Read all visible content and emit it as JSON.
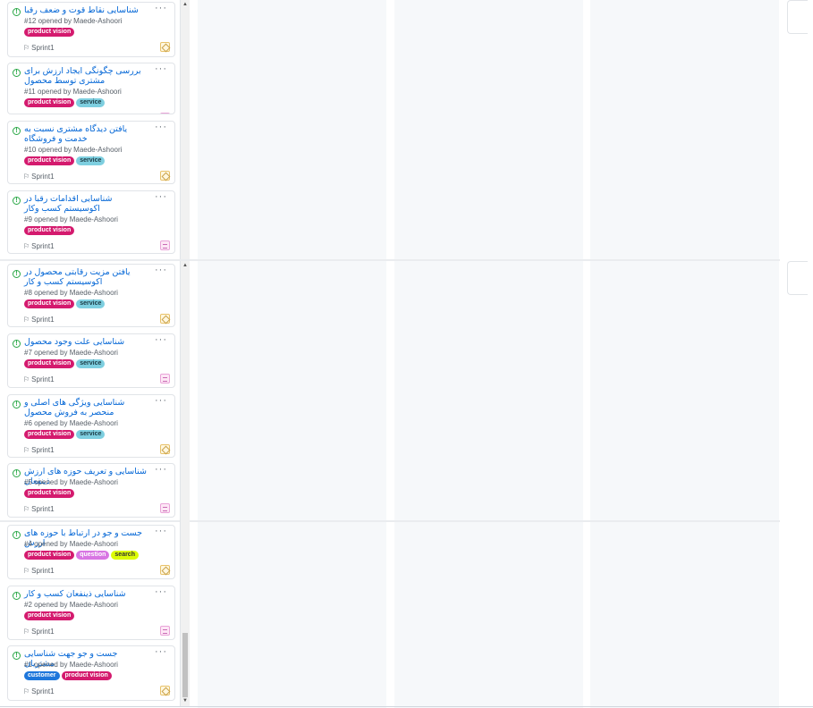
{
  "cards": [
    {
      "title": "شناسایی نقاط قوت و ضعف رقبا",
      "meta": "#12 opened by Maede-Ashoori",
      "labels": [
        "product vision"
      ],
      "milestone": "Sprint1",
      "avatar": "avatar-gold"
    },
    {
      "title": "بررسی چگونگی ایجاد ارزش برای مشتری توسط محصول",
      "meta": "#11 opened by Maede-Ashoori",
      "labels": [
        "product vision",
        "service"
      ],
      "milestone": "Sprint1",
      "avatar": "avatar-pink"
    },
    {
      "title": "یافتن دیدگاه مشتری نسبت به خدمت و فروشگاه",
      "meta": "#10 opened by Maede-Ashoori",
      "labels": [
        "product vision",
        "service"
      ],
      "milestone": "Sprint1",
      "avatar": "avatar-gold"
    },
    {
      "title": "شناسایی اقدامات رقبا در اکوسیستم کسب وکار",
      "meta": "#9 opened by Maede-Ashoori",
      "labels": [
        "product vision"
      ],
      "milestone": "Sprint1",
      "avatar": "avatar-pink"
    },
    {
      "title": "یافتن مزیت رقابتی محصول در اکوسیستم کسب و کار",
      "meta": "#8 opened by Maede-Ashoori",
      "labels": [
        "product vision",
        "service"
      ],
      "milestone": "Sprint1",
      "avatar": "avatar-gold"
    },
    {
      "title": "شناسایی علت وجود محصول",
      "meta": "#7 opened by Maede-Ashoori",
      "labels": [
        "product vision",
        "service"
      ],
      "milestone": "Sprint1",
      "avatar": "avatar-pink"
    },
    {
      "title": "شناسایی ویژگی های اصلی و منحصر به فروش محصول",
      "meta": "#6 opened by Maede-Ashoori",
      "labels": [
        "product vision",
        "service"
      ],
      "milestone": "Sprint1",
      "avatar": "avatar-gold"
    },
    {
      "title": "شناسایی و تعریف حوزه های ارزش ذینفعان",
      "meta": "#5 opened by Maede-Ashoori",
      "labels": [
        "product vision"
      ],
      "milestone": "Sprint1",
      "avatar": "avatar-pink"
    },
    {
      "title": "جست و جو در ارتباط با حوزه های ارزش",
      "meta": "#4 opened by Maede-Ashoori",
      "labels": [
        "product vision",
        "question",
        "search"
      ],
      "milestone": "Sprint1",
      "avatar": "avatar-gold"
    },
    {
      "title": "شناسایی ذینفعان کسب و کار",
      "meta": "#2 opened by Maede-Ashoori",
      "labels": [
        "product vision"
      ],
      "milestone": "Sprint1",
      "avatar": "avatar-pink"
    },
    {
      "title": "جست و جو جهت شناسایی مشتریان",
      "meta": "#1 opened by Maede-Ashoori",
      "labels": [
        "customer",
        "product vision"
      ],
      "milestone": "Sprint1",
      "avatar": "avatar-gold"
    }
  ],
  "label_colors": {
    "product vision": {
      "bg": "#d41a6e",
      "fg": "#ffffff"
    },
    "service": {
      "bg": "#7ecfe0",
      "fg": "#1b3a44"
    },
    "question": {
      "bg": "#d876e3",
      "fg": "#ffffff"
    },
    "search": {
      "bg": "#dcfc05",
      "fg": "#333333"
    },
    "customer": {
      "bg": "#1d76db",
      "fg": "#ffffff"
    }
  },
  "more_glyph": "···",
  "state_icon": "open-issue-icon",
  "milestone_icon": "milestone-icon"
}
